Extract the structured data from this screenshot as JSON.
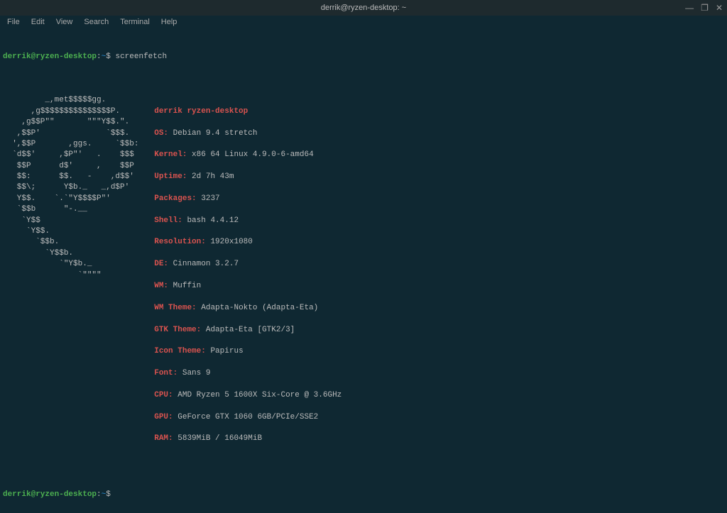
{
  "window": {
    "title": "derrik@ryzen-desktop: ~"
  },
  "menu": {
    "file": "File",
    "edit": "Edit",
    "view": "View",
    "search": "Search",
    "terminal": "Terminal",
    "help": "Help"
  },
  "prompt1": {
    "userhost": "derrik@ryzen-desktop",
    "colon": ":",
    "path": "~",
    "dollar": "$",
    "command": "screenfetch"
  },
  "logo": "         _,met$$$$$gg.          \n      ,g$$$$$$$$$$$$$$$P.       \n    ,g$$P\"\"       \"\"\"Y$$.\".     \n   ,$$P'              `$$$.     \n  ',$$P       ,ggs.     `$$b:   \n  `d$$'     ,$P\"'   .    $$$    \n   $$P      d$'     ,    $$P    \n   $$:      $$.   -    ,d$$'    \n   $$\\;      Y$b._   _,d$P'     \n   Y$$.    `.`\"Y$$$$P\"'         \n   `$$b      \"-.__              \n    `Y$$                        \n     `Y$$.                      \n       `$$b.                    \n         `Y$$b.                 \n            `\"Y$b._             \n                `\"\"\"\"           ",
  "info": {
    "header": "derrik ryzen-desktop",
    "os_k": "OS:",
    "os_v": " Debian 9.4 stretch",
    "kernel_k": "Kernel:",
    "kernel_v": " x86 64 Linux 4.9.0-6-amd64",
    "uptime_k": "Uptime:",
    "uptime_v": " 2d 7h 43m",
    "packages_k": "Packages:",
    "packages_v": " 3237",
    "shell_k": "Shell:",
    "shell_v": " bash 4.4.12",
    "resolution_k": "Resolution:",
    "resolution_v": " 1920x1080",
    "de_k": "DE:",
    "de_v": " Cinnamon 3.2.7",
    "wm_k": "WM:",
    "wm_v": " Muffin",
    "wmtheme_k": "WM Theme:",
    "wmtheme_v": " Adapta-Nokto (Adapta-Eta)",
    "gtktheme_k": "GTK Theme:",
    "gtktheme_v": " Adapta-Eta [GTK2/3]",
    "icontheme_k": "Icon Theme:",
    "icontheme_v": " Papirus",
    "font_k": "Font:",
    "font_v": " Sans 9",
    "cpu_k": "CPU:",
    "cpu_v": " AMD Ryzen 5 1600X Six-Core @ 3.6GHz",
    "gpu_k": "GPU:",
    "gpu_v": " GeForce GTX 1060 6GB/PCIe/SSE2",
    "ram_k": "RAM:",
    "ram_v": " 5839MiB / 16049MiB"
  },
  "prompt2": {
    "userhost": "derrik@ryzen-desktop",
    "colon": ":",
    "path": "~",
    "dollar": "$"
  }
}
